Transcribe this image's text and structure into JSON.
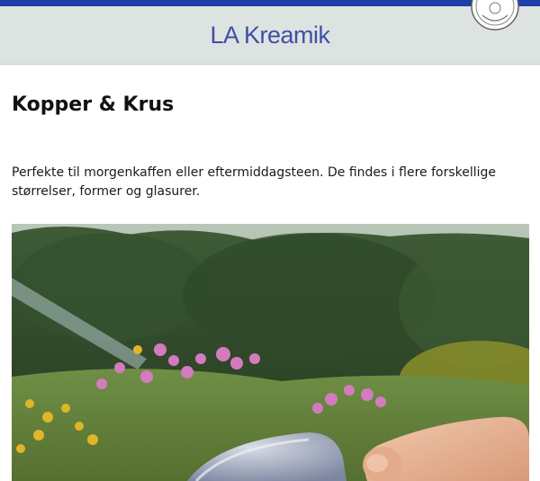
{
  "header": {
    "site_title": "LA Kreamik",
    "logo_icon": "circular-stamp-logo-icon"
  },
  "page": {
    "title": "Kopper & Krus",
    "intro": "Perfekte til morgenkaffen eller eftermiddagsteen. De findes i flere forskellige størrelser, former og glasurer."
  },
  "photo": {
    "subject": "garden-flowers-with-hand-holding-mug"
  },
  "colors": {
    "top_bar": "#1e3fa8",
    "header_bg": "#dde3e1",
    "title_blue": "#3f4fa6"
  }
}
